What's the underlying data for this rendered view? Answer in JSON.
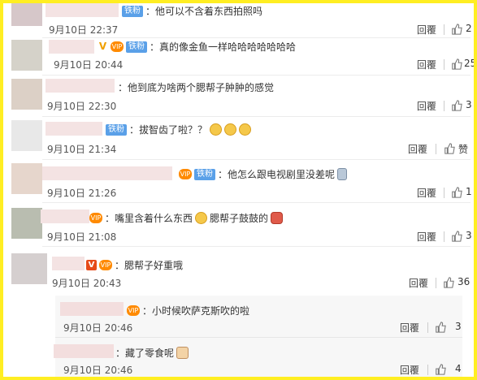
{
  "comments": [
    {
      "text": "：他可以不含着东西拍照吗",
      "badge": "铁粉",
      "time": "9月10日 22:37",
      "reply": "回覆",
      "likes": "2"
    },
    {
      "text": "：真的像金鱼一样哈哈哈哈哈哈哈",
      "badge": "铁粉",
      "time": "9月10日 20:44",
      "reply": "回覆",
      "likes": "25"
    },
    {
      "text": "：他到底为啥两个腮帮子肿肿的感觉",
      "time": "9月10日 22:30",
      "reply": "回覆",
      "likes": "3"
    },
    {
      "text": "：拔智齿了啦？？",
      "badge": "铁粉",
      "time": "9月10日 21:34",
      "reply": "回覆",
      "likes": "赞"
    },
    {
      "text": "：他怎么跟电视剧里没差呢",
      "badge": "铁粉",
      "time": "9月10日 21:26",
      "reply": "回覆",
      "likes": "1"
    },
    {
      "text": "：嘴里含着什么东西",
      "text2": "腮帮子鼓鼓的",
      "time": "9月10日 21:08",
      "reply": "回覆",
      "likes": "3"
    },
    {
      "text": "：腮帮子好重哦",
      "time": "9月10日 20:43",
      "reply": "回覆",
      "likes": "36"
    }
  ],
  "replies": [
    {
      "text": "：小时候吹萨克斯吹的啦",
      "time": "9月10日 20:46",
      "reply": "回覆",
      "likes": "3"
    },
    {
      "text": "：藏了零食呢",
      "time": "9月10日 20:46",
      "reply": "回覆",
      "likes": "4"
    }
  ],
  "icons": {
    "like": "thumbs-up-icon",
    "emoji": "emoji-face-icon"
  },
  "colors": {
    "frame": "#ffee22",
    "fan_badge": "#5aa0e8",
    "vip_badge": "#ff8a00"
  }
}
